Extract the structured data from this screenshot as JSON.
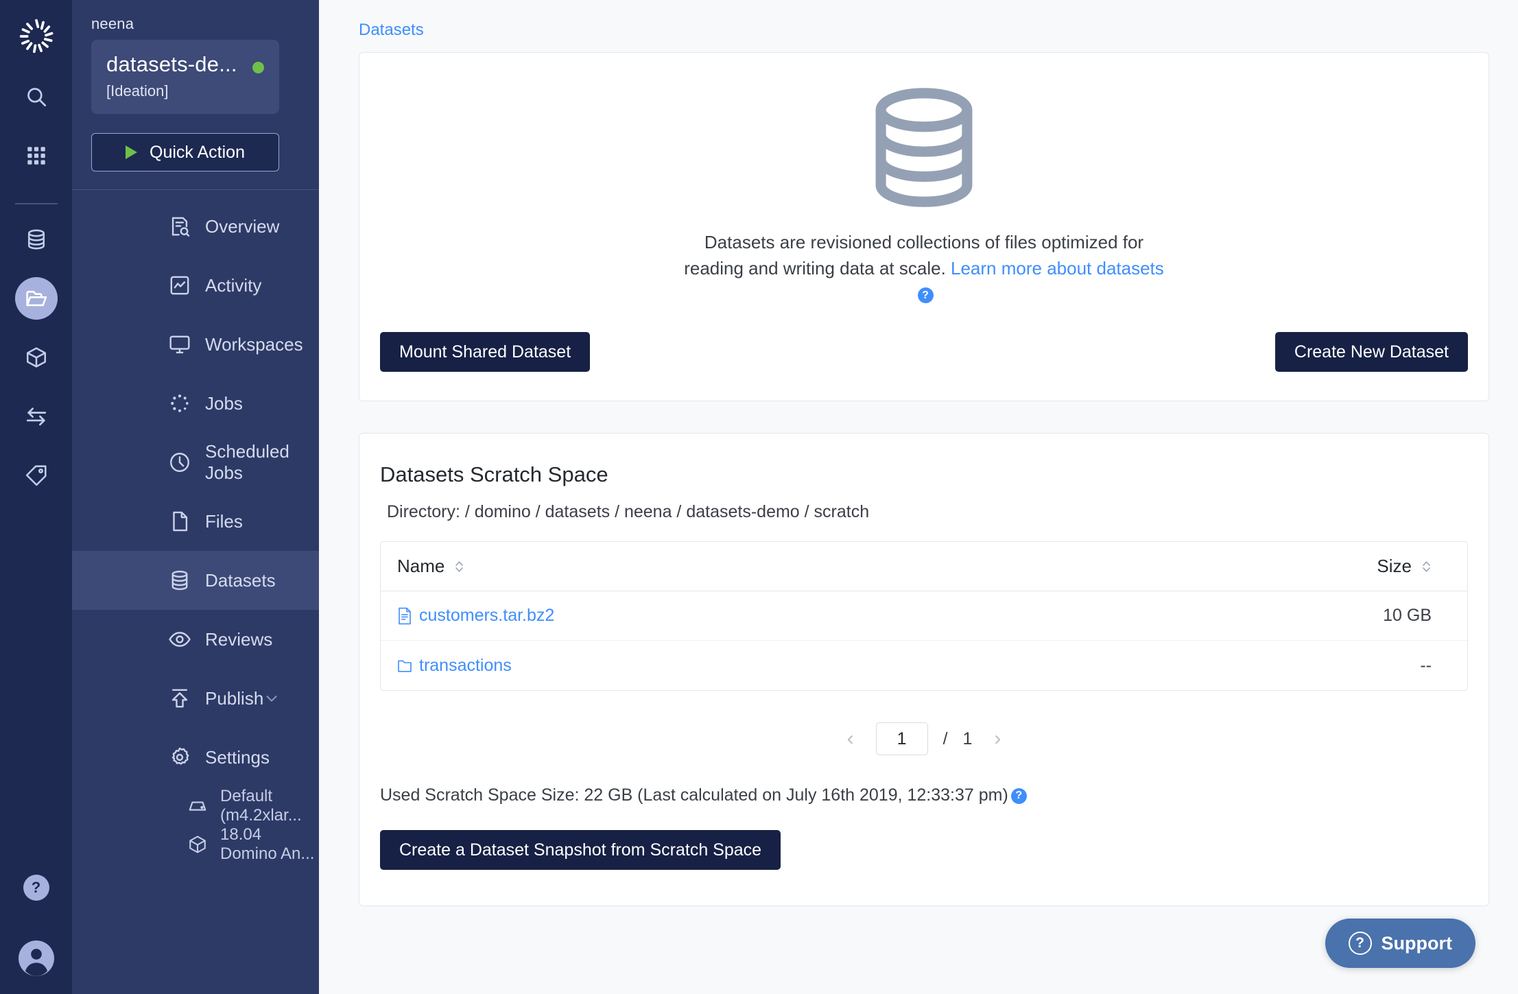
{
  "rail": {
    "logo_icon": "domino-logo-icon",
    "items": [
      {
        "name": "search-icon",
        "label": "Search",
        "active": false
      },
      {
        "name": "grid-apps-icon",
        "label": "Apps",
        "active": false
      },
      {
        "name": "database-icon",
        "label": "Data",
        "active": false
      },
      {
        "name": "folder-open-icon",
        "label": "Projects",
        "active": true
      },
      {
        "name": "cube-icon",
        "label": "Environments",
        "active": false
      },
      {
        "name": "transfer-arrows-icon",
        "label": "Transfers",
        "active": false
      },
      {
        "name": "tag-icon",
        "label": "Tags",
        "active": false
      }
    ],
    "help_label": "?",
    "avatar_icon": "user-avatar-icon"
  },
  "sidebar": {
    "owner": "neena",
    "project_name": "datasets-de...",
    "project_stage": "[Ideation]",
    "status_color": "#6fc04a",
    "quick_action_label": "Quick Action",
    "items": [
      {
        "label": "Overview",
        "icon": "overview-icon",
        "selected": false
      },
      {
        "label": "Activity",
        "icon": "activity-icon",
        "selected": false
      },
      {
        "label": "Workspaces",
        "icon": "workspaces-icon",
        "selected": false
      },
      {
        "label": "Jobs",
        "icon": "jobs-icon",
        "selected": false
      },
      {
        "label": "Scheduled Jobs",
        "icon": "clock-icon",
        "selected": false
      },
      {
        "label": "Files",
        "icon": "file-icon",
        "selected": false
      },
      {
        "label": "Datasets",
        "icon": "datasets-icon",
        "selected": true
      },
      {
        "label": "Reviews",
        "icon": "eye-icon",
        "selected": false
      },
      {
        "label": "Publish",
        "icon": "publish-icon",
        "selected": false,
        "chevron": true
      },
      {
        "label": "Settings",
        "icon": "gear-icon",
        "selected": false
      }
    ],
    "sub_items": [
      {
        "label": "Default (m4.2xlar...",
        "icon": "hardware-tier-icon"
      },
      {
        "label": "18.04 Domino An...",
        "icon": "environment-cube-icon"
      }
    ]
  },
  "main": {
    "breadcrumb": "Datasets",
    "hero": {
      "illustration_icon": "database-stack-icon",
      "description_prefix": "Datasets are revisioned collections of files optimized for reading and writing data at scale. ",
      "learn_more_label": "Learn more about datasets",
      "help_badge": "?",
      "mount_button": "Mount Shared Dataset",
      "create_button": "Create New Dataset"
    },
    "scratch": {
      "title": "Datasets Scratch Space",
      "directory": "Directory: / domino / datasets / neena / datasets-demo / scratch",
      "columns": [
        "Name",
        "Size"
      ],
      "rows": [
        {
          "icon": "file-icon",
          "name": "customers.tar.bz2",
          "size": "10 GB"
        },
        {
          "icon": "folder-icon",
          "name": "transactions",
          "size": "--"
        }
      ],
      "pagination": {
        "prev": "‹",
        "current": "1",
        "separator": "/",
        "total": "1",
        "next": "›"
      },
      "used_space": "Used Scratch Space Size: 22 GB (Last calculated on July 16th 2019, 12:33:37 pm)",
      "used_space_help": "?",
      "snapshot_button": "Create a Dataset Snapshot from Scratch Space"
    }
  },
  "support": {
    "label": "Support",
    "icon": "question-circle-icon",
    "badge": "?",
    "color": "#4a72ac"
  },
  "colors": {
    "accent_blue": "#3f8efc",
    "dark_navy": "#1d2951",
    "sidebar_navy": "#2e3a66",
    "button_dark": "#172145"
  }
}
